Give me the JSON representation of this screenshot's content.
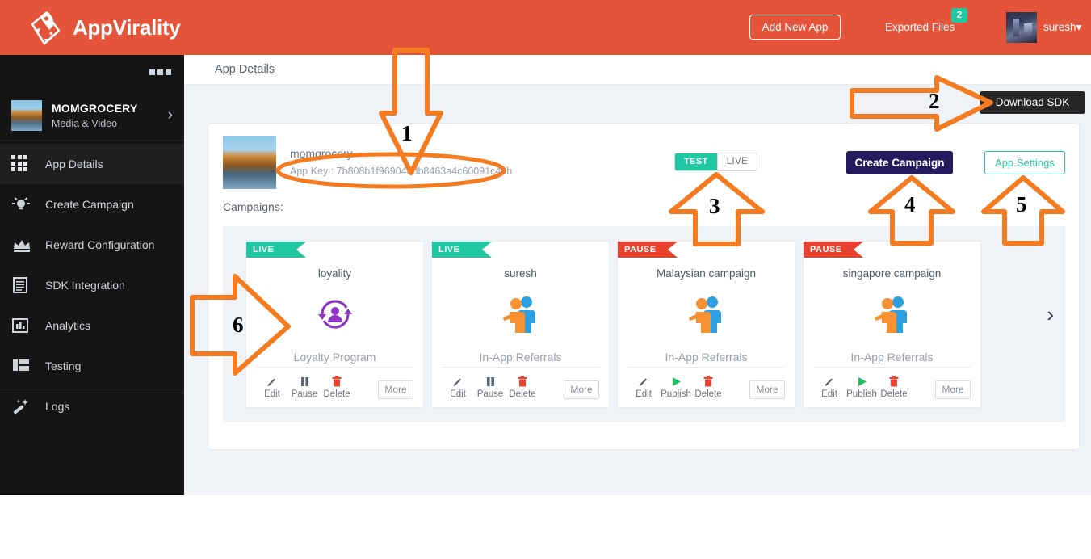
{
  "header": {
    "logo_text": "AppVirality",
    "logo_icon": "rocket-phone-icon",
    "add_app_label": "Add New App",
    "exported_files_label": "Exported Files",
    "exported_files_badge": "2",
    "username": "suresh",
    "user_caret": "▾",
    "brand_color": "#e4543a"
  },
  "sidebar": {
    "toggle_icon": "menu-dots-icon",
    "app_name": "MOMGROCERY",
    "app_category": "Media & Video",
    "app_chevron": "›",
    "items": [
      {
        "label": "App Details",
        "icon": "grid-icon",
        "active": true
      },
      {
        "label": "Create Campaign",
        "icon": "bulb-icon",
        "active": false
      },
      {
        "label": "Reward Configuration",
        "icon": "crown-icon",
        "active": false
      },
      {
        "label": "SDK Integration",
        "icon": "document-icon",
        "active": false
      },
      {
        "label": "Analytics",
        "icon": "bar-chart-icon",
        "active": false
      },
      {
        "label": "Testing",
        "icon": "layout-icon",
        "active": false
      },
      {
        "label": "Logs",
        "icon": "magic-wand-icon",
        "active": false
      }
    ]
  },
  "topbar": {
    "title": "App Details"
  },
  "main": {
    "download_sdk_label": "Download SDK",
    "app_display_name": "momgrocery",
    "app_key_label": "App Key : 7b808b1f969048db8463a4c60091c49b",
    "campaigns_label": "Campaigns:",
    "env_toggle": {
      "test_label": "TEST",
      "live_label": "LIVE",
      "selected": "TEST",
      "active_color": "#1fc8a0"
    },
    "create_campaign_label": "Create Campaign",
    "app_settings_label": "App Settings",
    "next_chevron": "›",
    "cards": [
      {
        "status": "LIVE",
        "status_color": "#1fc8a0",
        "title": "loyality",
        "icon": "loyalty-program-icon",
        "type": "Loyalty Program",
        "actions": [
          {
            "label": "Edit",
            "icon": "pencil-icon"
          },
          {
            "label": "Pause",
            "icon": "pause-icon"
          },
          {
            "label": "Delete",
            "icon": "trash-icon"
          }
        ],
        "more_label": "More"
      },
      {
        "status": "LIVE",
        "status_color": "#1fc8a0",
        "title": "suresh",
        "icon": "in-app-referrals-icon",
        "type": "In-App Referrals",
        "actions": [
          {
            "label": "Edit",
            "icon": "pencil-icon"
          },
          {
            "label": "Pause",
            "icon": "pause-icon"
          },
          {
            "label": "Delete",
            "icon": "trash-icon"
          }
        ],
        "more_label": "More"
      },
      {
        "status": "PAUSE",
        "status_color": "#e8412d",
        "title": "Malaysian campaign",
        "icon": "in-app-referrals-icon",
        "type": "In-App Referrals",
        "actions": [
          {
            "label": "Edit",
            "icon": "pencil-icon"
          },
          {
            "label": "Publish",
            "icon": "play-icon"
          },
          {
            "label": "Delete",
            "icon": "trash-icon"
          }
        ],
        "more_label": "More"
      },
      {
        "status": "PAUSE",
        "status_color": "#e8412d",
        "title": "singapore campaign",
        "icon": "in-app-referrals-icon",
        "type": "In-App Referrals",
        "actions": [
          {
            "label": "Edit",
            "icon": "pencil-icon"
          },
          {
            "label": "Publish",
            "icon": "play-icon"
          },
          {
            "label": "Delete",
            "icon": "trash-icon"
          }
        ],
        "more_label": "More"
      }
    ]
  },
  "annotations": {
    "color": "#f47b20",
    "markers": [
      {
        "number": "1",
        "shape": "arrow-down",
        "target": "app-key"
      },
      {
        "number": "2",
        "shape": "arrow-right",
        "target": "download-sdk-button"
      },
      {
        "number": "3",
        "shape": "arrow-up",
        "target": "env-toggle"
      },
      {
        "number": "4",
        "shape": "arrow-up",
        "target": "create-campaign-button"
      },
      {
        "number": "5",
        "shape": "arrow-up",
        "target": "app-settings-button"
      },
      {
        "number": "6",
        "shape": "arrow-right",
        "target": "campaign-card-1"
      }
    ],
    "highlight_oval": "app-key"
  }
}
